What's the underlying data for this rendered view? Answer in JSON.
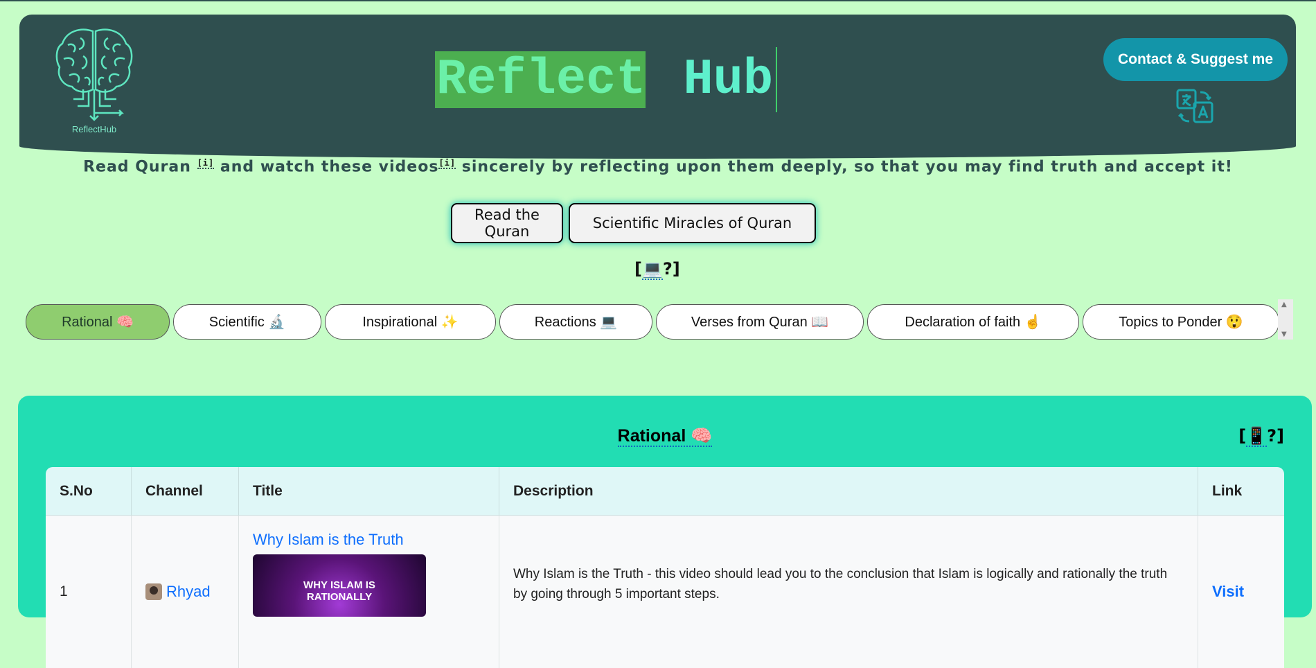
{
  "header": {
    "logo_caption": "ReflectHub",
    "brand_word1": "Reflect",
    "brand_word2": "Hub",
    "contact_label": "Contact & Suggest me",
    "translate_icon": "translate-icon"
  },
  "tagline": {
    "part1": "Read Quran ",
    "sup1": "[i]",
    "part2": " and watch these videos",
    "sup2": "[i]",
    "part3": " sincerely by reflecting upon them deeply, so that you may find truth and accept it!"
  },
  "buttons": {
    "read_quran": "Read the Quran",
    "scientific_miracles": "Scientific Miracles of Quran"
  },
  "help_top": {
    "open": "[",
    "icon": "💻",
    "q": "?]"
  },
  "tabs": [
    {
      "label": "Rational 🧠",
      "active": true
    },
    {
      "label": "Scientific 🔬",
      "active": false
    },
    {
      "label": "Inspirational ✨",
      "active": false
    },
    {
      "label": "Reactions 💻",
      "active": false
    },
    {
      "label": "Verses from Quran 📖",
      "active": false
    },
    {
      "label": "Declaration of faith ☝️",
      "active": false
    },
    {
      "label": "Topics to Ponder 😲",
      "active": false
    }
  ],
  "panel": {
    "title": "Rational 🧠",
    "help": {
      "open": "[",
      "icon": "📱",
      "q": "?]"
    }
  },
  "table": {
    "headers": [
      "S.No",
      "Channel",
      "Title",
      "Description",
      "Link"
    ],
    "rows": [
      {
        "sno": "1",
        "channel": "Rhyad",
        "title": "Why Islam is the Truth",
        "thumb_line1": "WHY ISLAM IS",
        "thumb_line2": "RATIONALLY",
        "description": "Why Islam is the Truth - this video should lead you to the conclusion that Islam is logically and rationally the truth by going through 5 important steps.",
        "link": "Visit"
      }
    ]
  },
  "colors": {
    "background": "#c6fdc7",
    "header": "#2f4f4f",
    "accent_teal": "#1395a9",
    "panel": "#22ddb3",
    "active_tab": "#8fcd6f"
  }
}
